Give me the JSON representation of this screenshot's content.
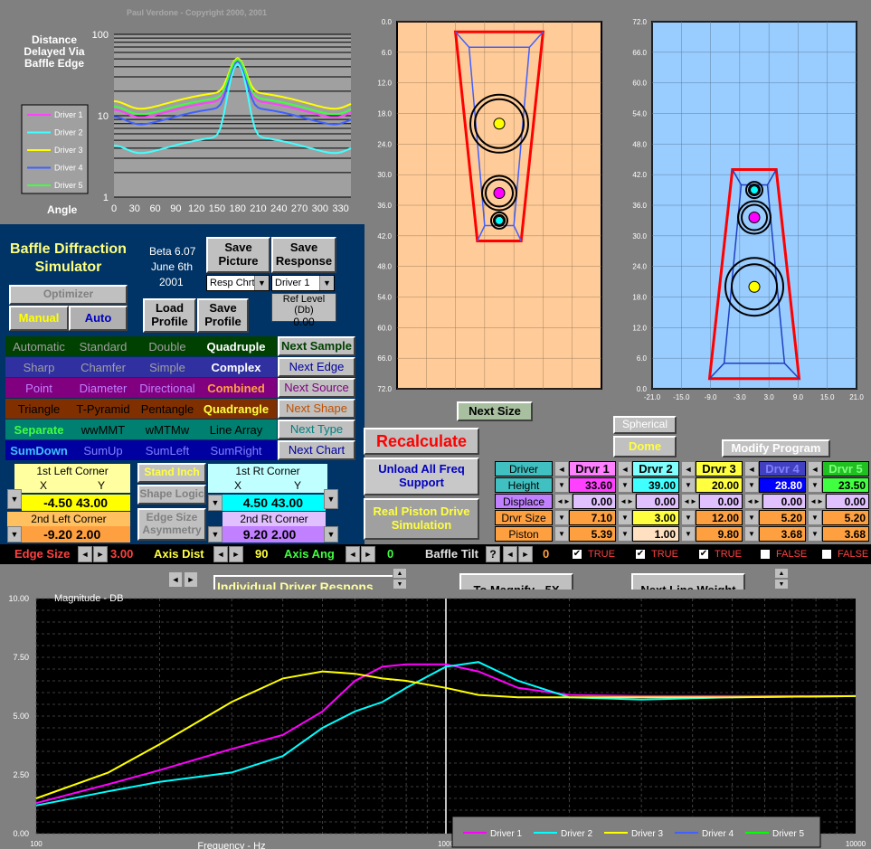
{
  "copyright": "Paul Verdone  -  Copyright 2000, 2001",
  "polar": {
    "title": "Distance Delayed Via Baffle Edge",
    "angle_label": "Angle",
    "yticks": [
      "100",
      "10",
      "1"
    ],
    "xticks": [
      "0",
      "30",
      "60",
      "90",
      "120",
      "150",
      "180",
      "210",
      "240",
      "270",
      "300",
      "330"
    ],
    "legend": [
      "Driver 1",
      "Driver 2",
      "Driver 3",
      "Driver 4",
      "Driver 5"
    ]
  },
  "app": {
    "title": "Baffle Diffraction Simulator",
    "version": "Beta 6.07",
    "date": "June 6th",
    "year": "2001"
  },
  "buttons": {
    "save_picture": "Save Picture",
    "save_response": "Save Response",
    "load_profile": "Load Profile",
    "save_profile": "Save Profile",
    "optimizer": "Optimizer",
    "manual": "Manual",
    "auto": "Auto",
    "next_size": "Next Size",
    "spherical": "Spherical",
    "dome": "Dome",
    "modify_program": "Modify Program",
    "recalculate": "Recalculate",
    "unload_all": "Unload All Freq Support",
    "real_piston": "Real Piston Drive Simulation",
    "stand_inch": "Stand Inch",
    "shape_logic": "Shape Logic",
    "edge_size_asym": "Edge Size Asymmetry",
    "individual": "Individual Driver Respons",
    "magnify": "To Magnify - 5X",
    "next_line_weight": "Next Line Weight"
  },
  "selects": {
    "resp_chart": "Resp Chrt",
    "driver": "Driver 1"
  },
  "ref_level": {
    "label": "Ref Level (Db)",
    "value": "0.00"
  },
  "option_rows": [
    {
      "items": [
        "Automatic",
        "Standard",
        "Double",
        "Quadruple"
      ],
      "next": "Next Sample"
    },
    {
      "items": [
        "Sharp",
        "Chamfer",
        "Simple",
        "Complex"
      ],
      "next": "Next Edge"
    },
    {
      "items": [
        "Point",
        "Diameter",
        "Directional",
        "Combined"
      ],
      "next": "Next Source"
    },
    {
      "items": [
        "Triangle",
        "T-Pyramid",
        "Pentangle",
        "Quadrangle"
      ],
      "next": "Next Shape"
    },
    {
      "items": [
        "Separate",
        "wwMMT",
        "wMTMw",
        "Line Array"
      ],
      "next": "Next Type"
    },
    {
      "items": [
        "SumDown",
        "SumUp",
        "SumLeft",
        "SumRight"
      ],
      "next": "Next Chart"
    }
  ],
  "corners": {
    "left1": {
      "title": "1st Left Corner",
      "x_label": "X",
      "y_label": "Y",
      "x": "-4.50",
      "y": "43.00"
    },
    "left2": {
      "title": "2nd Left Corner",
      "x": "-9.20",
      "y": "2.00"
    },
    "right1": {
      "title": "1st Rt Corner",
      "x_label": "X",
      "y_label": "Y",
      "x": "4.50",
      "y": "43.00"
    },
    "right2": {
      "title": "2nd Rt Corner",
      "x": "9.20",
      "y": "2.00"
    }
  },
  "bottom_bar": {
    "edge_size_label": "Edge Size",
    "edge_size_value": "3.00",
    "axis_dist_label": "Axis Dist",
    "axis_dist_value": "90",
    "axis_ang_label": "Axis Ang",
    "axis_ang_value": "0",
    "baffle_tilt_label": "Baffle Tilt",
    "baffle_tilt_value": "0",
    "question": "?",
    "flags": [
      "TRUE",
      "TRUE",
      "TRUE",
      "FALSE",
      "FALSE"
    ]
  },
  "driver_table": {
    "row_labels": [
      "Driver",
      "Height",
      "Displace",
      "Drvr Size",
      "Piston"
    ],
    "drivers": [
      {
        "name": "Drvr 1",
        "height": "33.60",
        "displace": "0.00",
        "size": "7.10",
        "piston": "5.39"
      },
      {
        "name": "Drvr 2",
        "height": "39.00",
        "displace": "0.00",
        "size": "3.00",
        "piston": "1.00"
      },
      {
        "name": "Drvr 3",
        "height": "20.00",
        "displace": "0.00",
        "size": "12.00",
        "piston": "9.80"
      },
      {
        "name": "Drvr 4",
        "height": "28.80",
        "displace": "0.00",
        "size": "5.20",
        "piston": "3.68"
      },
      {
        "name": "Drvr 5",
        "height": "23.50",
        "displace": "0.00",
        "size": "5.20",
        "piston": "3.68"
      }
    ]
  },
  "front_view": {
    "yticks": [
      "0.0",
      "6.0",
      "12.0",
      "18.0",
      "24.0",
      "30.0",
      "36.0",
      "42.0",
      "48.0",
      "54.0",
      "60.0",
      "66.0",
      "72.0"
    ]
  },
  "side_view": {
    "yticks": [
      "72.0",
      "66.0",
      "60.0",
      "54.0",
      "48.0",
      "42.0",
      "36.0",
      "30.0",
      "24.0",
      "18.0",
      "12.0",
      "6.0",
      "0.0"
    ],
    "xticks": [
      "-21.0",
      "-15.0",
      "-9.0",
      "-3.0",
      "3.0",
      "9.0",
      "15.0",
      "21.0"
    ]
  },
  "chart_data": {
    "type": "line",
    "title": "Magnitude  -  DB",
    "xlabel": "Frequency  -  Hz",
    "ylabel": "",
    "x_scale": "log",
    "xlim": [
      100,
      10000
    ],
    "ylim": [
      0,
      10
    ],
    "yticks": [
      "0.00",
      "2.50",
      "5.00",
      "7.50",
      "10.00"
    ],
    "xticks": [
      "100",
      "1000",
      "10000"
    ],
    "legend": "bottom-right",
    "series": [
      {
        "name": "Driver 1",
        "color": "#ff00ff",
        "x": [
          100,
          150,
          200,
          300,
          400,
          500,
          600,
          700,
          800,
          1000,
          1200,
          1500,
          2000,
          3000,
          5000,
          10000
        ],
        "y": [
          1.3,
          2.1,
          2.7,
          3.6,
          4.2,
          5.2,
          6.5,
          7.1,
          7.2,
          7.2,
          6.9,
          6.2,
          5.9,
          5.85,
          5.85,
          5.85
        ]
      },
      {
        "name": "Driver 2",
        "color": "#00ffff",
        "x": [
          100,
          150,
          200,
          300,
          400,
          500,
          600,
          700,
          800,
          1000,
          1200,
          1500,
          2000,
          3000,
          5000,
          10000
        ],
        "y": [
          1.2,
          1.8,
          2.2,
          2.6,
          3.3,
          4.5,
          5.2,
          5.6,
          6.2,
          7.1,
          7.3,
          6.5,
          5.8,
          5.7,
          5.8,
          5.85
        ]
      },
      {
        "name": "Driver 3",
        "color": "#ffff00",
        "x": [
          100,
          150,
          200,
          300,
          400,
          500,
          600,
          700,
          800,
          1000,
          1200,
          1500,
          2000,
          3000,
          5000,
          10000
        ],
        "y": [
          1.5,
          2.6,
          3.8,
          5.6,
          6.6,
          6.9,
          6.8,
          6.6,
          6.5,
          6.2,
          5.9,
          5.8,
          5.8,
          5.8,
          5.8,
          5.85
        ]
      },
      {
        "name": "Driver 4",
        "color": "#4060ff",
        "x": [],
        "y": []
      },
      {
        "name": "Driver 5",
        "color": "#00ff00",
        "x": [],
        "y": []
      }
    ]
  }
}
